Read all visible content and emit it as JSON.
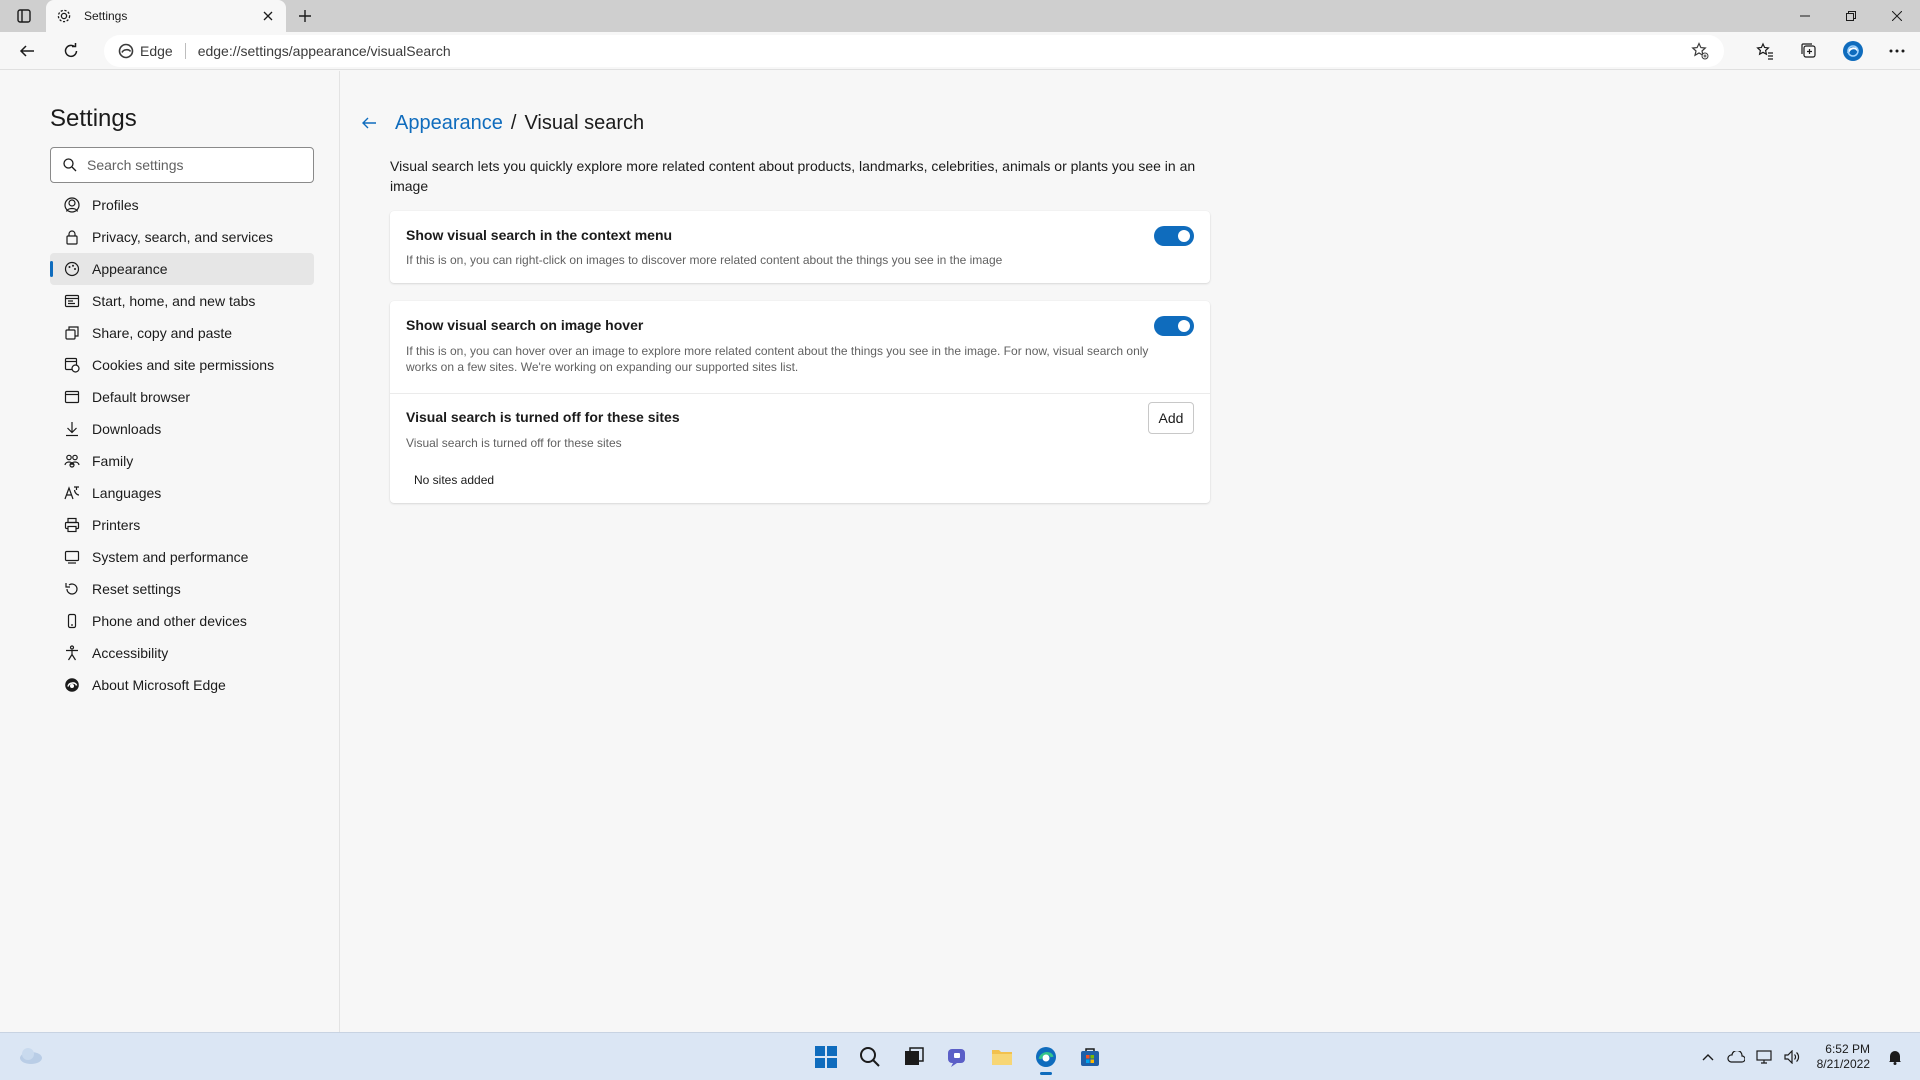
{
  "browser": {
    "tab_title": "Settings",
    "site_label": "Edge",
    "url": "edge://settings/appearance/visualSearch"
  },
  "sidebar": {
    "title": "Settings",
    "search_placeholder": "Search settings",
    "items": [
      {
        "label": "Profiles",
        "icon": "profile-icon"
      },
      {
        "label": "Privacy, search, and services",
        "icon": "lock-icon"
      },
      {
        "label": "Appearance",
        "icon": "appearance-icon",
        "active": true
      },
      {
        "label": "Start, home, and new tabs",
        "icon": "start-icon"
      },
      {
        "label": "Share, copy and paste",
        "icon": "share-icon"
      },
      {
        "label": "Cookies and site permissions",
        "icon": "cookies-icon"
      },
      {
        "label": "Default browser",
        "icon": "browser-icon"
      },
      {
        "label": "Downloads",
        "icon": "download-icon"
      },
      {
        "label": "Family",
        "icon": "family-icon"
      },
      {
        "label": "Languages",
        "icon": "language-icon"
      },
      {
        "label": "Printers",
        "icon": "printer-icon"
      },
      {
        "label": "System and performance",
        "icon": "system-icon"
      },
      {
        "label": "Reset settings",
        "icon": "reset-icon"
      },
      {
        "label": "Phone and other devices",
        "icon": "phone-icon"
      },
      {
        "label": "Accessibility",
        "icon": "accessibility-icon"
      },
      {
        "label": "About Microsoft Edge",
        "icon": "edge-icon"
      }
    ]
  },
  "main": {
    "breadcrumb_parent": "Appearance",
    "breadcrumb_separator": "/",
    "breadcrumb_current": "Visual search",
    "description": "Visual search lets you quickly explore more related content about products, landmarks, celebrities, animals or plants you see in an image",
    "context_menu": {
      "title": "Show visual search in the context menu",
      "desc": "If this is on, you can right-click on images to discover more related content about the things you see in the image",
      "enabled": true
    },
    "hover": {
      "title": "Show visual search on image hover",
      "desc": "If this is on, you can hover over an image to explore more related content about the things you see in the image. For now, visual search only works on a few sites. We're working on expanding our supported sites list.",
      "enabled": true
    },
    "blocked_sites": {
      "title": "Visual search is turned off for these sites",
      "desc": "Visual search is turned off for these sites",
      "add_label": "Add",
      "empty_label": "No sites added"
    }
  },
  "taskbar": {
    "time": "6:52 PM",
    "date": "8/21/2022"
  },
  "colors": {
    "accent": "#0f6cbd",
    "background": "#f7f7f7",
    "taskbar": "#dbe6f4"
  }
}
